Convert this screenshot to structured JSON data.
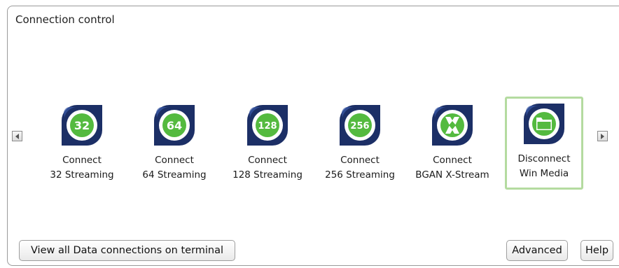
{
  "panel": {
    "title": "Connection control"
  },
  "tiles": [
    {
      "badge": "32",
      "line1": "Connect",
      "line2": "32 Streaming"
    },
    {
      "badge": "64",
      "line1": "Connect",
      "line2": "64 Streaming"
    },
    {
      "badge": "128",
      "line1": "Connect",
      "line2": "128 Streaming"
    },
    {
      "badge": "256",
      "line1": "Connect",
      "line2": "256 Streaming"
    },
    {
      "badge": "",
      "line1": "Connect",
      "line2": "BGAN X-Stream"
    },
    {
      "badge": "",
      "line1": "Disconnect",
      "line2": "Win Media"
    }
  ],
  "buttons": {
    "view_all": "View all Data connections on terminal",
    "advanced": "Advanced",
    "help": "Help"
  },
  "colors": {
    "icon_navy": "#1c2f66",
    "icon_green": "#54ba3f",
    "active_border": "#b4dba0"
  },
  "icons": {
    "scroll_left": "triangle-left-icon",
    "scroll_right": "triangle-right-icon",
    "xstream": "x-stream-icon",
    "win_media": "folder-icon"
  }
}
